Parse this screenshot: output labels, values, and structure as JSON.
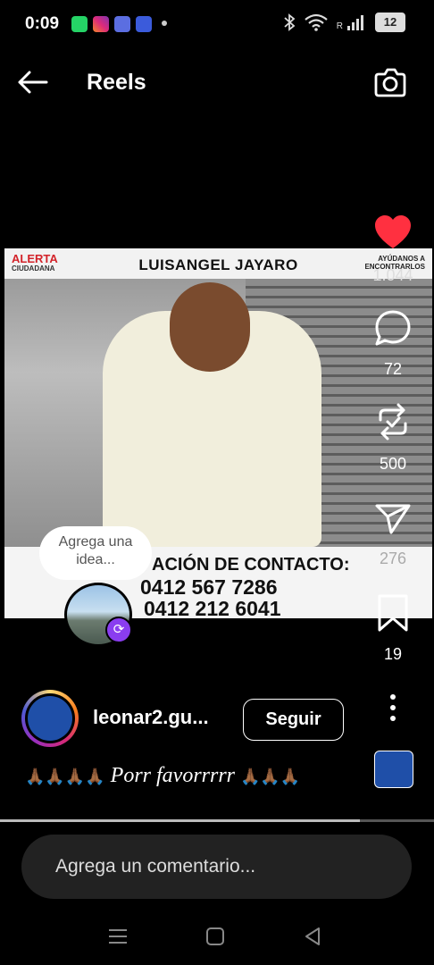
{
  "status_bar": {
    "time": "0:09",
    "battery": "12",
    "notification_icons": [
      "whatsapp-icon",
      "instagram-icon",
      "messenger-icon",
      "shield-icon"
    ],
    "signal_label": "R"
  },
  "header": {
    "title": "Reels"
  },
  "video": {
    "banner_left_line1": "ALERTA",
    "banner_left_line2": "CIUDADANA",
    "person_name": "LUISANGEL JAYARO",
    "banner_right_line1": "AYÚDANOS A",
    "banner_right_line2": "ENCONTRARLOS",
    "contact_label": "ACIÓN DE CONTACTO:",
    "phone1": "0412 567 7286",
    "phone2": "0412 212 6041"
  },
  "idea_bubble": {
    "text": "Agrega una idea..."
  },
  "rail": {
    "likes": "1.044",
    "comments": "72",
    "reposts": "500",
    "shares": "276",
    "saves": "19",
    "like_color": "#ff3040"
  },
  "author": {
    "username": "leonar2.gu...",
    "follow_label": "Seguir"
  },
  "caption": {
    "emoji_left": "🙏🏾🙏🏾🙏🏾🙏🏾",
    "text": "Porr favorrrrr",
    "emoji_right": "🙏🏾🙏🏾🙏🏾"
  },
  "progress": {
    "fraction": 0.83
  },
  "comment": {
    "placeholder": "Agrega un comentario..."
  }
}
